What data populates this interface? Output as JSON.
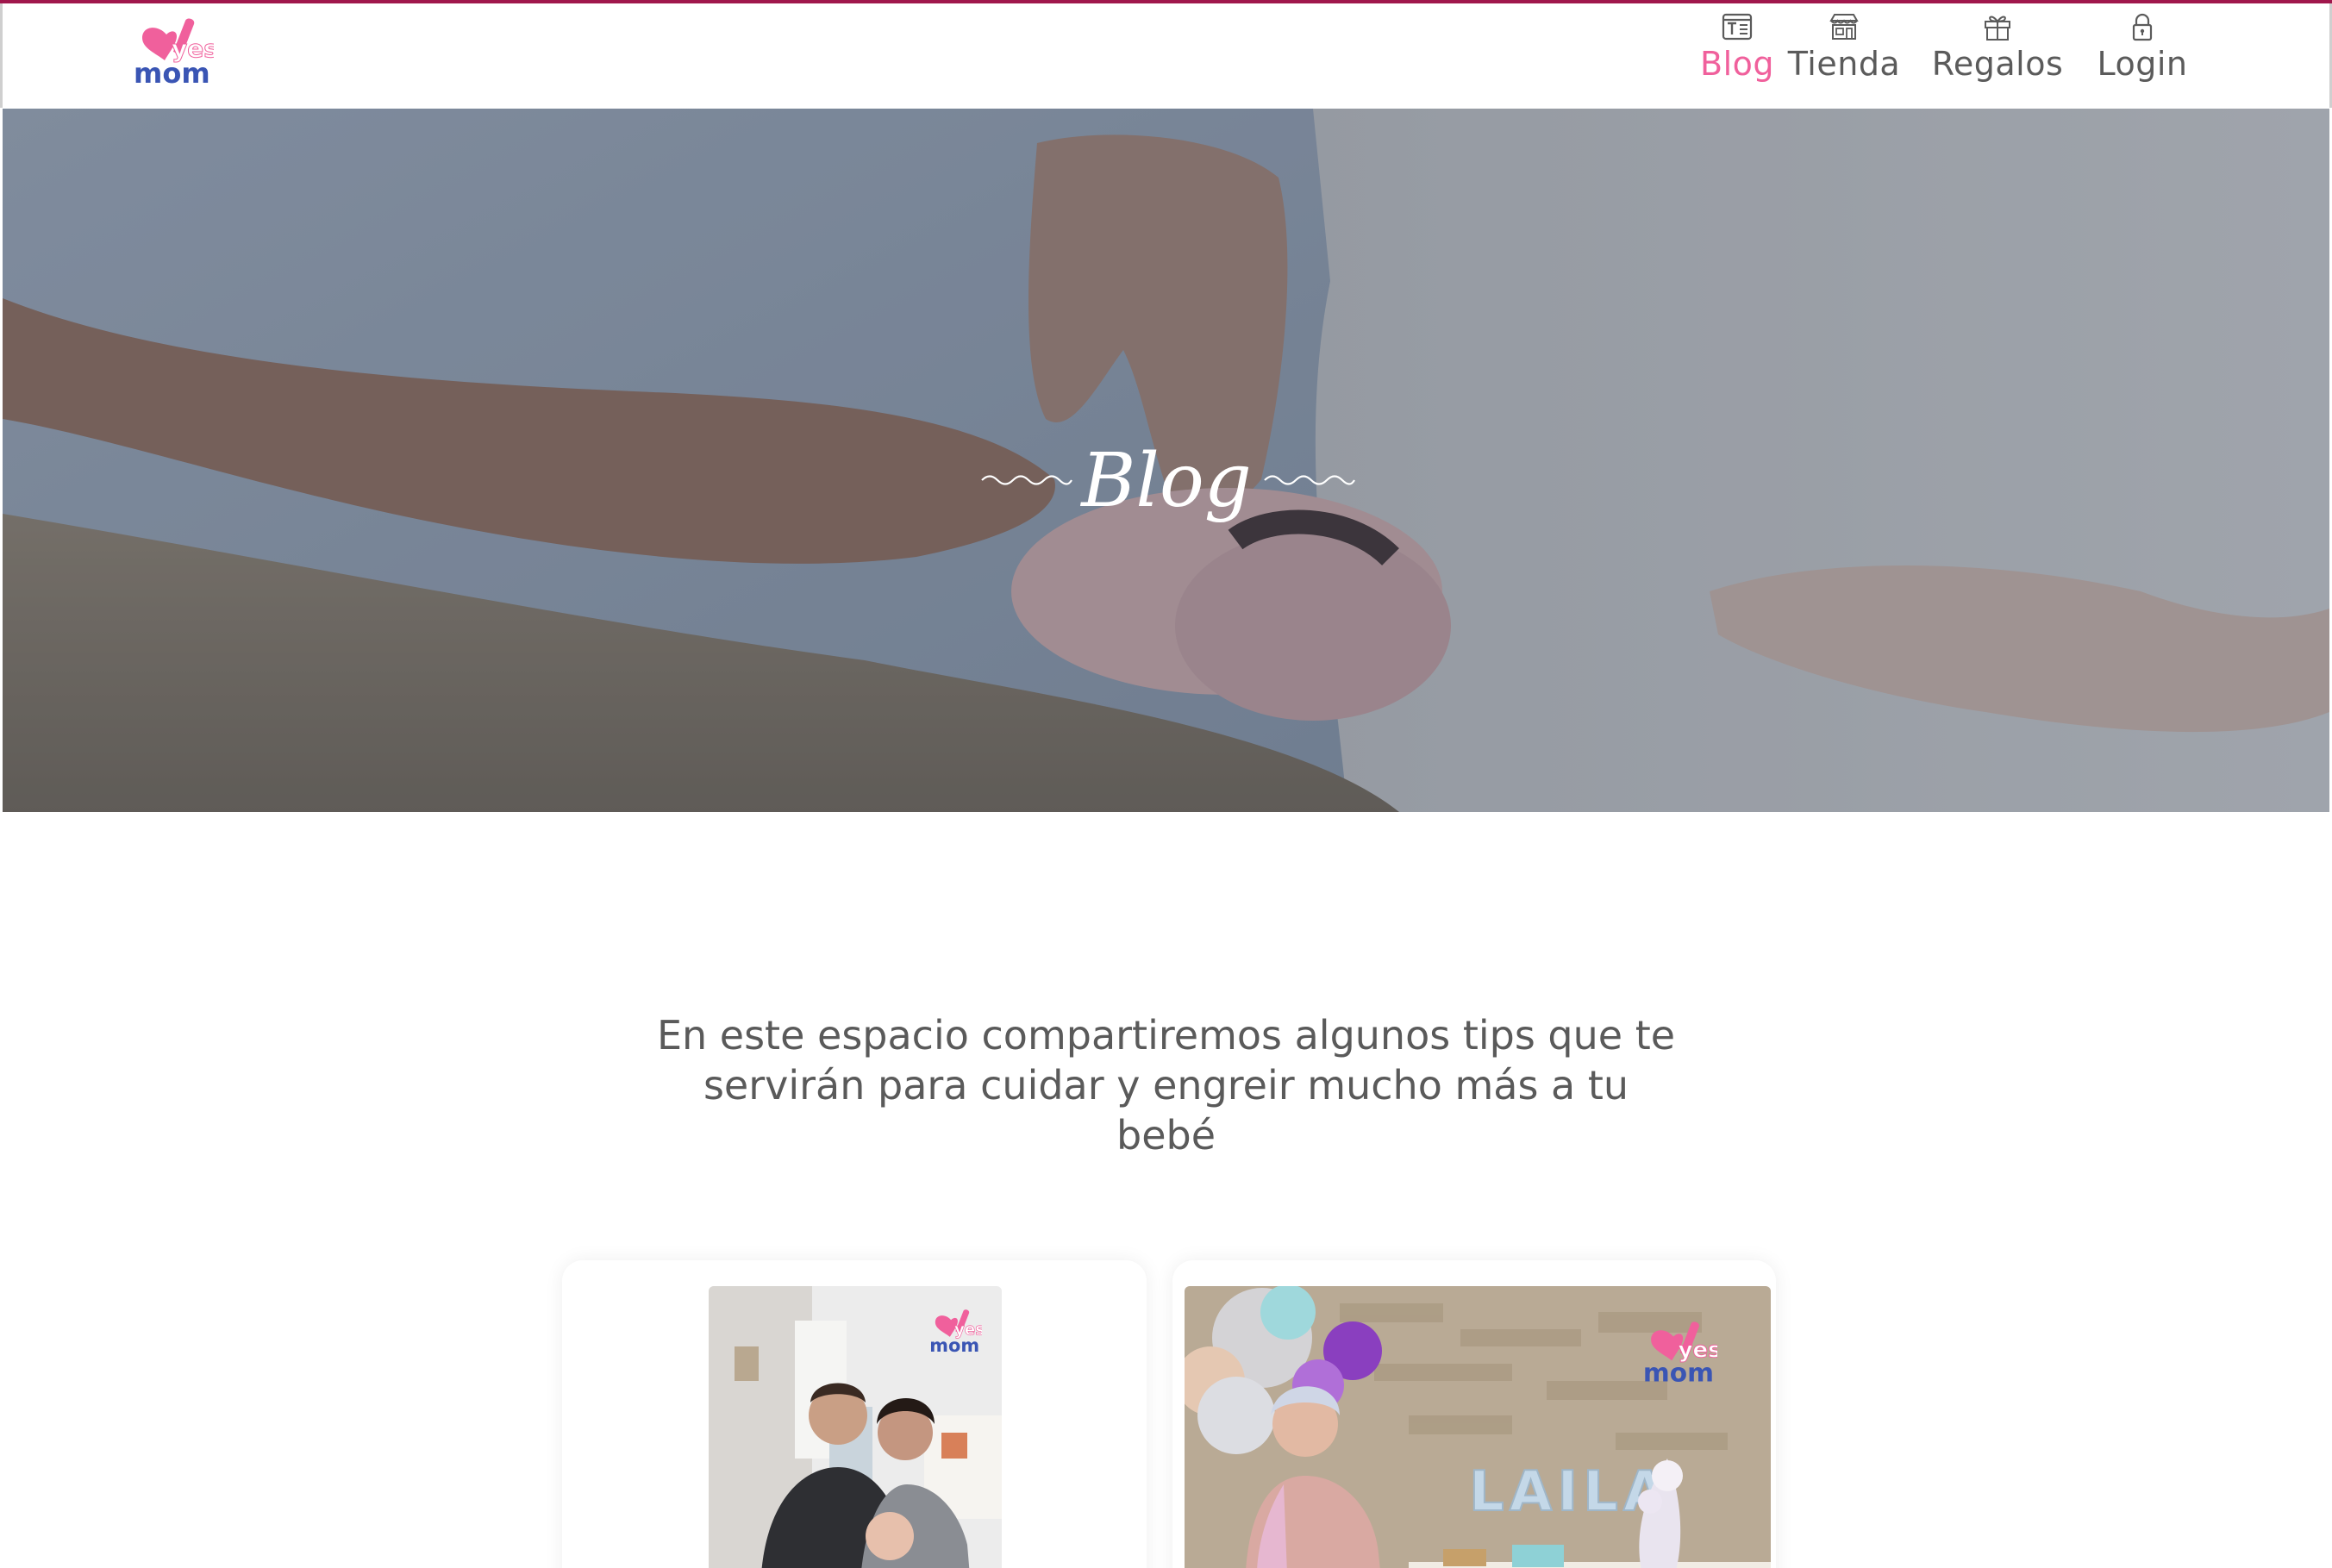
{
  "brand": {
    "logo_top": "yes",
    "logo_bottom": "mom",
    "pink": "#f0609c",
    "blue": "#3a55b4",
    "accent_line": "#a0174c"
  },
  "nav": {
    "items": [
      {
        "label": "Blog",
        "icon": "newspaper-icon",
        "active": true
      },
      {
        "label": "Tienda",
        "icon": "store-icon",
        "active": false
      },
      {
        "label": "Regalos",
        "icon": "gift-icon",
        "active": false
      },
      {
        "label": "Login",
        "icon": "lock-icon",
        "active": false
      }
    ]
  },
  "hero": {
    "title": "Blog"
  },
  "intro": {
    "text": "En este espacio compartiremos algunos tips que te servirán para cuidar y engreir mucho más a tu bebé"
  },
  "cards": [
    {
      "logo_top": "yes",
      "logo_bottom": "mom"
    },
    {
      "logo_top": "yes",
      "logo_bottom": "mom",
      "banner": "LAILA"
    }
  ]
}
